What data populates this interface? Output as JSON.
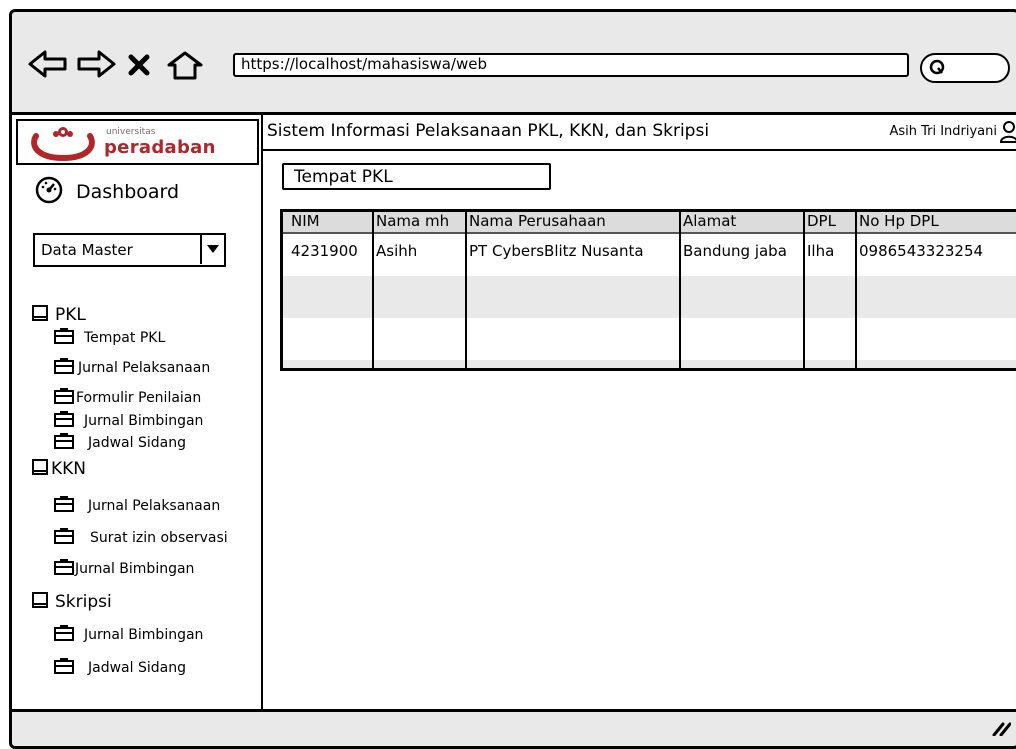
{
  "browser": {
    "url": "https://localhost/mahasiswa/web"
  },
  "brand": {
    "small": "universitas",
    "name": "peradaban"
  },
  "header": {
    "system_title": "Sistem Informasi Pelaksanaan PKL, KKN, dan Skripsi",
    "user_name": "Asih Tri Indriyani"
  },
  "sidebar": {
    "dashboard": "Dashboard",
    "select_value": "Data Master",
    "sections": [
      {
        "label": "PKL",
        "items": [
          "Tempat PKL",
          "Jurnal Pelaksanaan",
          "Formulir Penilaian",
          "Jurnal Bimbingan",
          "Jadwal Sidang"
        ]
      },
      {
        "label": "KKN",
        "items": [
          "Jurnal Pelaksanaan",
          "Surat izin observasi",
          "Jurnal Bimbingan"
        ]
      },
      {
        "label": "Skripsi",
        "items": [
          "Jurnal Bimbingan",
          "Jadwal Sidang"
        ]
      }
    ]
  },
  "page": {
    "title": "Tempat PKL"
  },
  "table": {
    "columns": [
      "NIM",
      "Nama mh",
      "Nama Perusahaan",
      "Alamat",
      "DPL",
      "No Hp DPL"
    ],
    "rows": [
      [
        "4231900",
        "Asihh",
        "PT CybersBlitz Nusanta",
        "Bandung jaba",
        "Ilha",
        "0986543323254"
      ]
    ]
  }
}
